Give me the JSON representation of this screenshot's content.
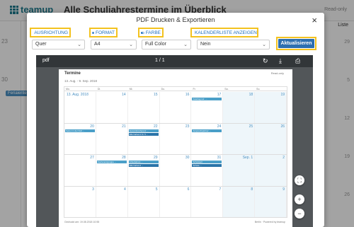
{
  "app": {
    "brand": "teamup",
    "title": "Alle Schuljahrestermine im Überblick",
    "readonly": "Read-only",
    "liste": "Liste",
    "side_days": [
      "23",
      "30"
    ],
    "side_event": "Feriaienter",
    "right_days": [
      "29",
      "5",
      "12",
      "19",
      "26"
    ]
  },
  "modal": {
    "title": "PDF Drucken & Exportieren",
    "close": "×",
    "options": [
      {
        "label": "AUSRICHTUNG",
        "icon": "orientation-icon",
        "value": "Quer"
      },
      {
        "label": "FORMAT",
        "icon": "format-icon",
        "value": "A4"
      },
      {
        "label": "FARBE",
        "icon": "color-toggle-icon",
        "value": "Full Color"
      },
      {
        "label": "KALENDERLISTE ANZEIGEN",
        "icon": "calendar-list-icon",
        "value": "Nein"
      }
    ],
    "apply": "Aktualisieren"
  },
  "viewer": {
    "name": "pdf",
    "page_indicator": "1 / 1",
    "icons": [
      "refresh-icon",
      "download-icon",
      "print-icon"
    ],
    "zoom_buttons": [
      "fit-icon",
      "zoom-in-icon",
      "zoom-out-icon"
    ]
  },
  "pdf_page": {
    "title": "Termine",
    "readonly": "Read-only",
    "range": "13. Aug. - 9. Sep. 2018",
    "weekdays": [
      "Mo.",
      "Di.",
      "Mi.",
      "Do.",
      "Fr.",
      "Sa.",
      "So."
    ],
    "weeks": [
      {
        "days": [
          "13. Aug. 2018",
          "14",
          "15",
          "16",
          "17",
          "18",
          "19"
        ],
        "events": [
          {
            "col": 4,
            "text": "Feiertag Lkr. ..."
          }
        ]
      },
      {
        "days": [
          "20",
          "21",
          "22",
          "23",
          "24",
          "25",
          "26"
        ],
        "events": [
          {
            "col": 0,
            "text": "Ferien in der Kult ..."
          },
          {
            "col": 2,
            "text": "Gesamtkonferenz ..."
          },
          {
            "col": 2,
            "text": "Elternabend Kl. 5 ..."
          },
          {
            "col": 4,
            "text": "Ansprechpartner ..."
          }
        ]
      },
      {
        "days": [
          "27",
          "28",
          "29",
          "30",
          "31",
          "Sep. 1",
          "2"
        ],
        "events": [
          {
            "col": 1,
            "text": "Konferenzgruppe ..."
          },
          {
            "col": 2,
            "text": "Arbeitskreis ..."
          },
          {
            "col": 2,
            "text": "Elternabend ..."
          },
          {
            "col": 4,
            "text": "Schulstart"
          },
          {
            "col": 4,
            "text": "Schule ..."
          }
        ]
      },
      {
        "days": [
          "3",
          "4",
          "5",
          "6",
          "7",
          "8",
          "9"
        ],
        "events": []
      }
    ],
    "footer_left": "Gedruckt am: 19.08.2018 10:55",
    "footer_right": "Berlin · Powered by teamup"
  }
}
